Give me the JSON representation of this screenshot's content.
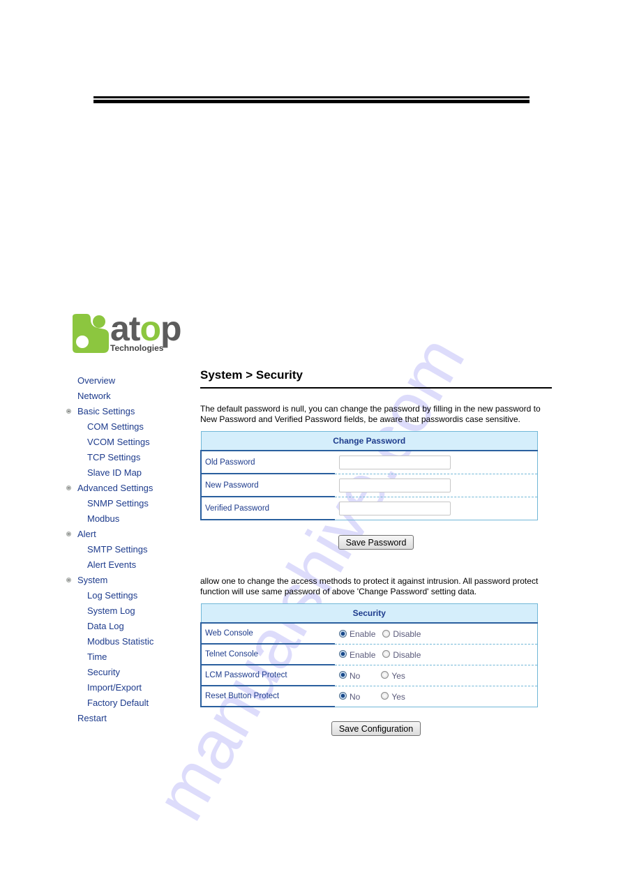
{
  "watermark": "manualshive.com",
  "logo": {
    "brand": "atop",
    "tagline": "Technologies",
    "colors": {
      "green": "#8cc63f",
      "gray": "#5c5c5c"
    }
  },
  "sidebar": {
    "items": [
      {
        "label": "Overview",
        "level": 0,
        "bullet": false
      },
      {
        "label": "Network",
        "level": 0,
        "bullet": false
      },
      {
        "label": "Basic Settings",
        "level": 0,
        "bullet": true
      },
      {
        "label": "COM Settings",
        "level": 1,
        "bullet": false
      },
      {
        "label": "VCOM Settings",
        "level": 1,
        "bullet": false
      },
      {
        "label": "TCP Settings",
        "level": 1,
        "bullet": false
      },
      {
        "label": "Slave ID Map",
        "level": 1,
        "bullet": false
      },
      {
        "label": "Advanced Settings",
        "level": 0,
        "bullet": true
      },
      {
        "label": "SNMP Settings",
        "level": 1,
        "bullet": false
      },
      {
        "label": "Modbus",
        "level": 1,
        "bullet": false
      },
      {
        "label": "Alert",
        "level": 0,
        "bullet": true
      },
      {
        "label": "SMTP Settings",
        "level": 1,
        "bullet": false
      },
      {
        "label": "Alert Events",
        "level": 1,
        "bullet": false
      },
      {
        "label": "System",
        "level": 0,
        "bullet": true
      },
      {
        "label": "Log Settings",
        "level": 1,
        "bullet": false
      },
      {
        "label": "System Log",
        "level": 1,
        "bullet": false
      },
      {
        "label": "Data Log",
        "level": 1,
        "bullet": false
      },
      {
        "label": "Modbus Statistic",
        "level": 1,
        "bullet": false
      },
      {
        "label": "Time",
        "level": 1,
        "bullet": false
      },
      {
        "label": "Security",
        "level": 1,
        "bullet": false
      },
      {
        "label": "Import/Export",
        "level": 1,
        "bullet": false
      },
      {
        "label": "Factory Default",
        "level": 1,
        "bullet": false
      },
      {
        "label": "Restart",
        "level": 0,
        "bullet": false
      }
    ]
  },
  "main": {
    "title": "System > Security",
    "intro": "The default password is null, you can change the password by filling in the new password to New Password and Verified Password fields, be aware that passwordis case sensitive.",
    "change_password": {
      "header": "Change Password",
      "fields": [
        {
          "label": "Old Password",
          "value": "",
          "placeholder": ""
        },
        {
          "label": "New Password",
          "value": "",
          "placeholder": ""
        },
        {
          "label": "Verified Password",
          "value": "",
          "placeholder": ""
        }
      ],
      "save_label": "Save Password"
    },
    "intro2": "allow one to change the access methods to protect it against intrusion. All password protect function will use same password of above 'Change Password' setting data.",
    "security": {
      "header": "Security",
      "rows": [
        {
          "label": "Web Console",
          "options": [
            "Enable",
            "Disable"
          ],
          "selected": "Enable"
        },
        {
          "label": "Telnet Console",
          "options": [
            "Enable",
            "Disable"
          ],
          "selected": "Enable"
        },
        {
          "label": "LCM Password Protect",
          "options": [
            "No",
            "Yes"
          ],
          "selected": "No"
        },
        {
          "label": "Reset Button Protect",
          "options": [
            "No",
            "Yes"
          ],
          "selected": "No"
        }
      ],
      "save_label": "Save Configuration"
    }
  },
  "colors": {
    "nav_text": "#1d3b8c",
    "table_header_bg": "#d5eefb",
    "table_border_dark": "#2a5f9e",
    "table_border_light": "#70b7d7",
    "watermark": "#dddcfb"
  }
}
